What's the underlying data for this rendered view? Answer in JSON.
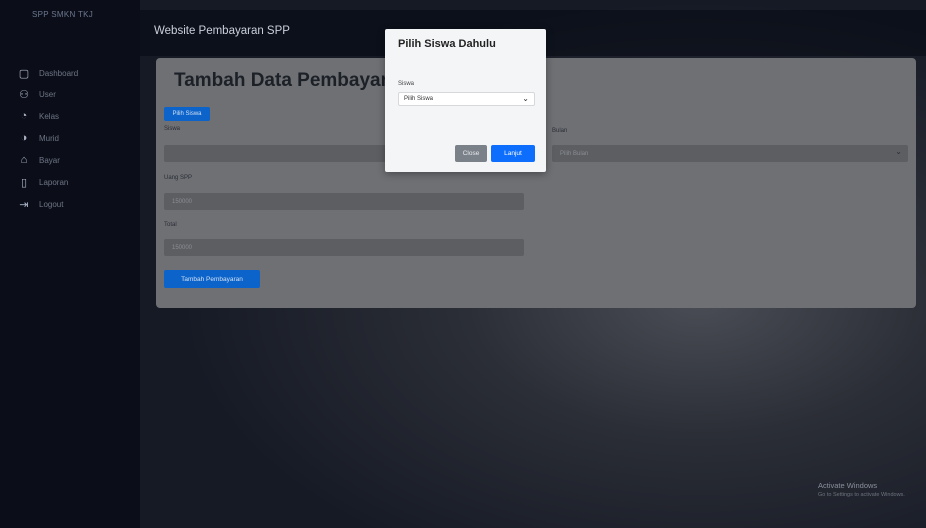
{
  "sidebar": {
    "brand": "SPP SMKN TKJ",
    "items": [
      {
        "icon": "dashboard-icon",
        "glyph": "▢",
        "label": "Dashboard"
      },
      {
        "icon": "user-icon",
        "glyph": "⚇",
        "label": "User"
      },
      {
        "icon": "class-icon",
        "glyph": "◔",
        "label": "Kelas"
      },
      {
        "icon": "student-icon",
        "glyph": "◑",
        "label": "Murid"
      },
      {
        "icon": "payment-icon",
        "glyph": "⌂",
        "label": "Bayar"
      },
      {
        "icon": "report-icon",
        "glyph": "▯",
        "label": "Laporan"
      },
      {
        "icon": "logout-icon",
        "glyph": "⇥",
        "label": "Logout"
      }
    ]
  },
  "header": {
    "title": "Website Pembayaran SPP"
  },
  "card": {
    "title": "Tambah Data Pembayaran",
    "small_button": "Pilih Siswa",
    "fields": {
      "siswa_label": "Siswa",
      "bulan_label": "Bulan",
      "bulan_value": "Pilih Bulan",
      "uang_spp_label": "Uang SPP",
      "uang_spp_value": "150000",
      "total_label": "Total",
      "total_value": "150000"
    },
    "submit_label": "Tambah Pembayaran"
  },
  "modal": {
    "title": "Pilih Siswa Dahulu",
    "label": "Siswa",
    "select_value": "Pilih Siswa",
    "close_label": "Close",
    "next_label": "Lanjut"
  },
  "watermark": {
    "line1": "Activate Windows",
    "line2": "Go to Settings to activate Windows."
  }
}
